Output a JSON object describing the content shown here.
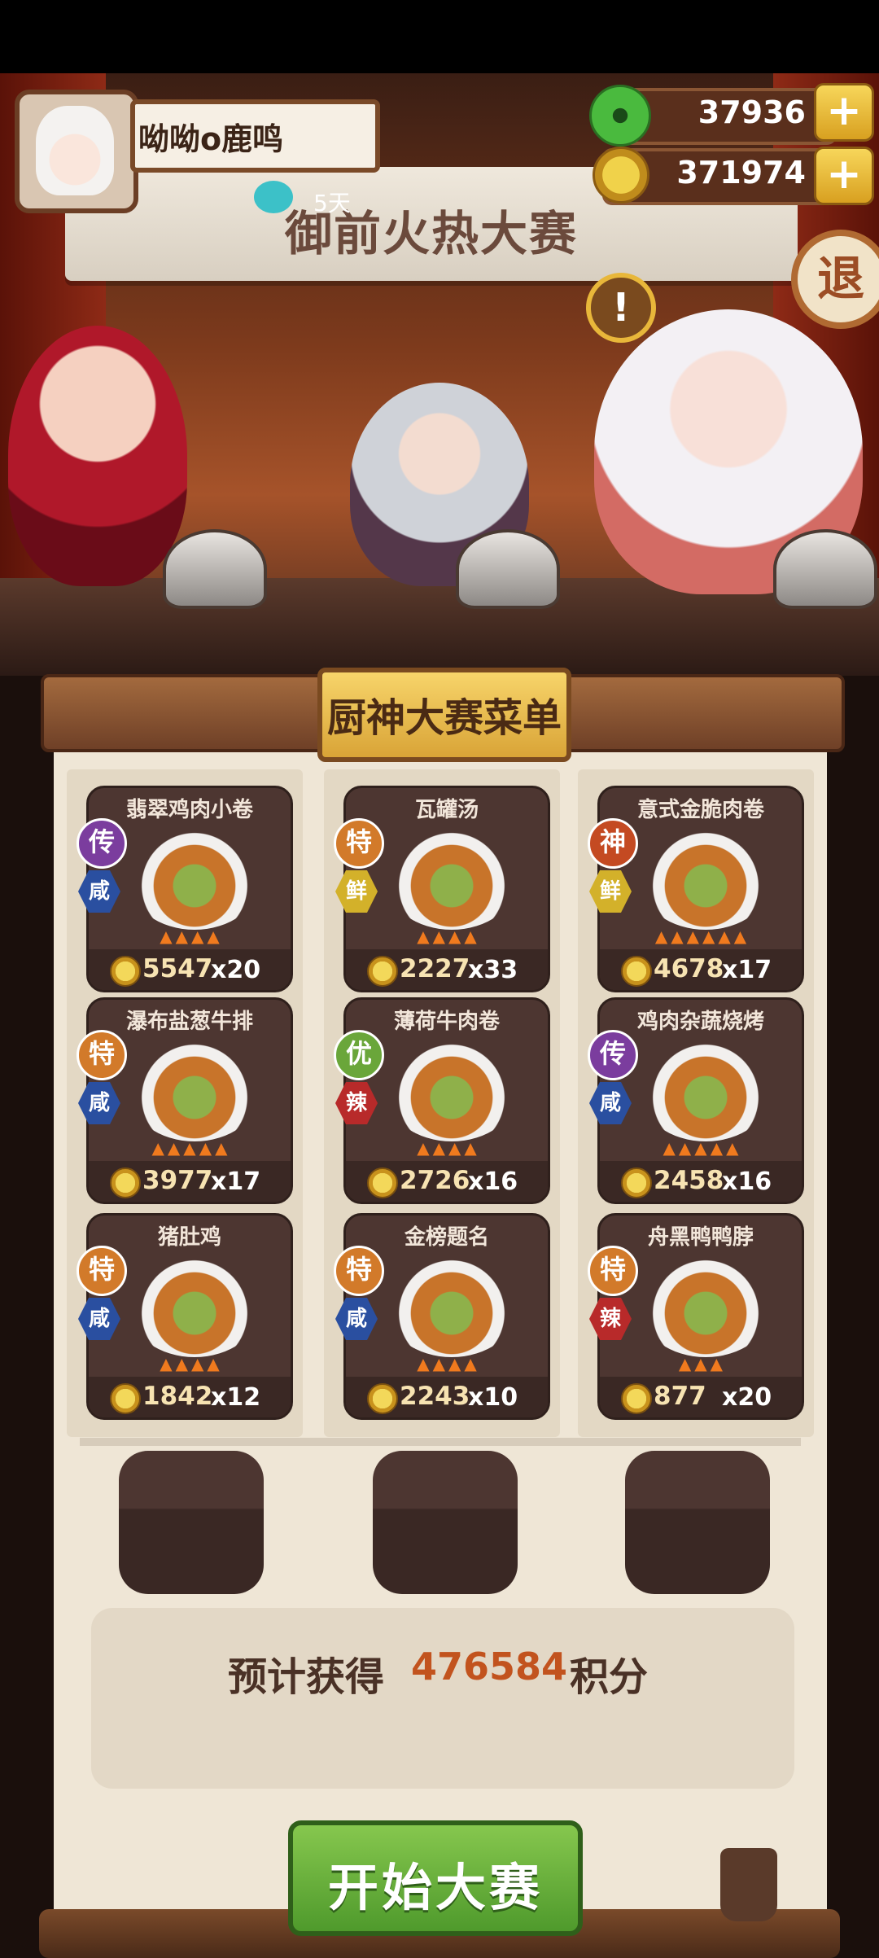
{
  "player": {
    "name": "呦呦o鹿鸣",
    "days": "5天"
  },
  "resources": {
    "jade": "37936",
    "coins": "371974"
  },
  "buttons": {
    "plus": "+",
    "exit": "退",
    "start": "开始大赛"
  },
  "event": {
    "title": "御前火热大赛",
    "alert": "!"
  },
  "menu": {
    "title": "厨神大赛菜单",
    "columns": [
      [
        {
          "name": "翡翠鸡肉小卷",
          "tier": "传",
          "flavor": "咸",
          "value": "5547",
          "count": "x20",
          "flames": 4,
          "tier_color": "#7b3d9e",
          "flavor_color": "#2a4fa0"
        },
        {
          "name": "瀑布盐葱牛排",
          "tier": "特",
          "flavor": "咸",
          "value": "3977",
          "count": "x17",
          "flames": 5,
          "tier_color": "#d27a2a",
          "flavor_color": "#2a4fa0"
        },
        {
          "name": "猪肚鸡",
          "tier": "特",
          "flavor": "咸",
          "value": "1842",
          "count": "x12",
          "flames": 4,
          "tier_color": "#d27a2a",
          "flavor_color": "#2a4fa0"
        }
      ],
      [
        {
          "name": "瓦罐汤",
          "tier": "特",
          "flavor": "鲜",
          "value": "2227",
          "count": "x33",
          "flames": 4,
          "tier_color": "#d27a2a",
          "flavor_color": "#d3b12a"
        },
        {
          "name": "薄荷牛肉卷",
          "tier": "优",
          "flavor": "辣",
          "value": "2726",
          "count": "x16",
          "flames": 4,
          "tier_color": "#6aa63a",
          "flavor_color": "#b82a2a"
        },
        {
          "name": "金榜题名",
          "tier": "特",
          "flavor": "咸",
          "value": "2243",
          "count": "x10",
          "flames": 4,
          "tier_color": "#d27a2a",
          "flavor_color": "#2a4fa0"
        }
      ],
      [
        {
          "name": "意式金脆肉卷",
          "tier": "神",
          "flavor": "鲜",
          "value": "4678",
          "count": "x17",
          "flames": 6,
          "tier_color": "#c44a22",
          "flavor_color": "#d3b12a"
        },
        {
          "name": "鸡肉杂蔬烧烤",
          "tier": "传",
          "flavor": "咸",
          "value": "2458",
          "count": "x16",
          "flames": 5,
          "tier_color": "#7b3d9e",
          "flavor_color": "#2a4fa0"
        },
        {
          "name": "舟黑鸭鸭脖",
          "tier": "特",
          "flavor": "辣",
          "value": "877",
          "count": "x20",
          "flames": 3,
          "tier_color": "#d27a2a",
          "flavor_color": "#b82a2a"
        }
      ]
    ]
  },
  "estimate": {
    "label": "预计获得",
    "value": "476584",
    "unit": "积分"
  }
}
